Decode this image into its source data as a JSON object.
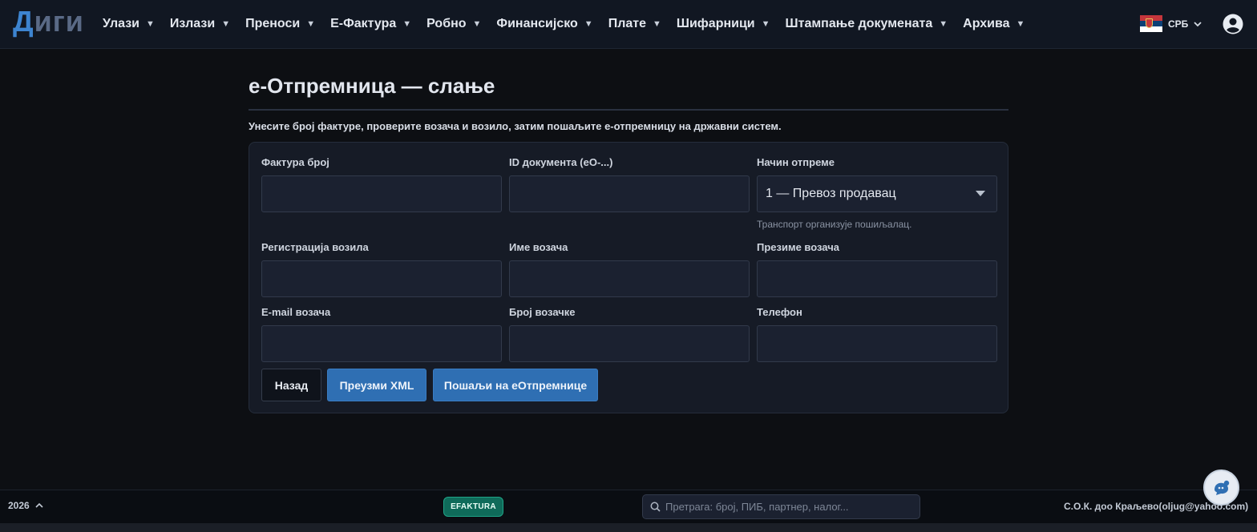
{
  "header": {
    "logo": "Диги",
    "nav": [
      {
        "label": "Улази"
      },
      {
        "label": "Излази"
      },
      {
        "label": "Преноси"
      },
      {
        "label": "Е-Фактура"
      },
      {
        "label": "Робно"
      },
      {
        "label": "Финансијско"
      },
      {
        "label": "Плате"
      },
      {
        "label": "Шифарници"
      },
      {
        "label": "Штампање докумената"
      },
      {
        "label": "Архива"
      }
    ],
    "language": "СРБ"
  },
  "main": {
    "title": "е-Отпремница — слање",
    "subtitle": "Унесите број фактуре, проверите возача и возило, затим пошаљите е-отпремницу на државни систем.",
    "form": {
      "invoice_number": {
        "label": "Фактура број",
        "value": ""
      },
      "document_id": {
        "label": "ID документа (eO-...)",
        "value": ""
      },
      "shipping_method": {
        "label": "Начин отпреме",
        "value": "1 — Превоз продавац",
        "hint": "Транспорт организује пошиљалац."
      },
      "vehicle_registration": {
        "label": "Регистрација возила",
        "value": ""
      },
      "driver_first_name": {
        "label": "Име возача",
        "value": ""
      },
      "driver_last_name": {
        "label": "Презиме возача",
        "value": ""
      },
      "driver_email": {
        "label": "E-mail возача",
        "value": ""
      },
      "license_number": {
        "label": "Број возачке",
        "value": ""
      },
      "phone": {
        "label": "Телефон",
        "value": ""
      }
    },
    "buttons": {
      "back": "Назад",
      "download_xml": "Преузми XML",
      "send": "Пошаљи на еОтпремнице"
    }
  },
  "footer": {
    "year": "2026",
    "badge": "EFAKTURA",
    "search_placeholder": "Претрага: број, ПИБ, партнер, налог...",
    "company": "С.О.К. доо Краљево(oljug@yahoo.com)"
  },
  "colors": {
    "accent": "#2f6fb3",
    "badge": "#0f6b5a",
    "background": "#0d0f13",
    "card": "#161b26"
  },
  "icons": [
    "serbia-flag-icon",
    "chevron-down-icon",
    "user-account-icon",
    "chevron-up-icon",
    "search-icon",
    "chat-assistant-icon"
  ]
}
